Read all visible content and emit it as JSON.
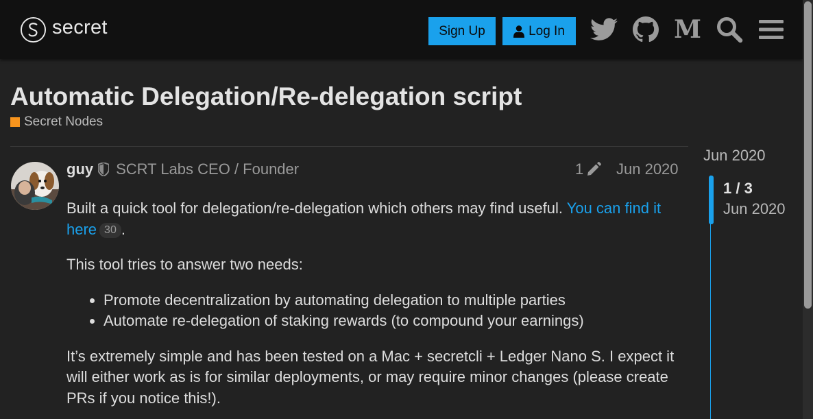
{
  "header": {
    "logo_text": "secret",
    "signup_label": "Sign Up",
    "login_label": "Log In",
    "icons": [
      "twitter-icon",
      "github-icon",
      "medium-icon",
      "search-icon",
      "menu-icon"
    ]
  },
  "topic": {
    "title": "Automatic Delegation/Re-delegation script",
    "category": "Secret Nodes",
    "category_color": "#f7941d"
  },
  "post": {
    "username": "guy",
    "user_title": "SCRT Labs CEO / Founder",
    "edit_count": "1",
    "date": "Jun 2020",
    "intro_text": "Built a quick tool for delegation/re-delegation which others may find useful. ",
    "link_text": "You can find it here",
    "link_clicks": "30",
    "intro_end": ".",
    "needs_text": "This tool tries to answer two needs:",
    "bullets": [
      "Promote decentralization by automating delegation to multiple parties",
      "Automate re-delegation of staking rewards (to compound your earnings)"
    ],
    "closing_text": "It’s extremely simple and has been tested on a Mac + secretcli + Ledger Nano S. I expect it will either work as is for similar deployments, or may require minor changes (please create PRs if you notice this!)."
  },
  "timeline": {
    "start_date": "Jun 2020",
    "position": "1 / 3",
    "current_date": "Jun 2020"
  },
  "colors": {
    "accent": "#1aa1ec",
    "background": "#222222",
    "header": "#111111"
  }
}
